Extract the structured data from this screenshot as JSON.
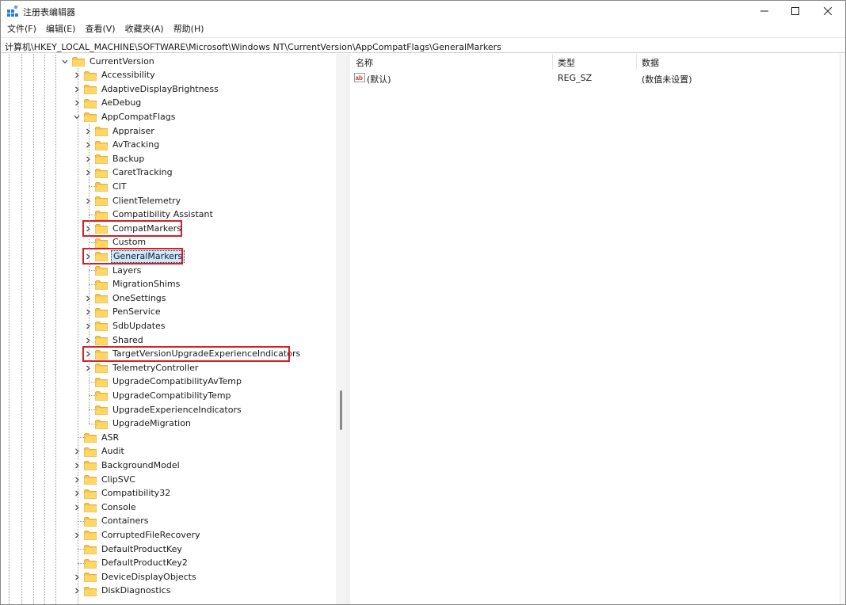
{
  "window": {
    "title": "注册表编辑器",
    "buttons": [
      "minimize",
      "maximize",
      "close"
    ]
  },
  "menu": [
    "文件(F)",
    "编辑(E)",
    "查看(V)",
    "收藏夹(A)",
    "帮助(H)"
  ],
  "address": "计算机\\HKEY_LOCAL_MACHINE\\SOFTWARE\\Microsoft\\Windows NT\\CurrentVersion\\AppCompatFlags\\GeneralMarkers",
  "tree": {
    "root": {
      "label": "CurrentVersion",
      "expanded": true
    },
    "level1_before": [
      {
        "label": "Accessibility",
        "expandable": true
      },
      {
        "label": "AdaptiveDisplayBrightness",
        "expandable": true
      },
      {
        "label": "AeDebug",
        "expandable": true
      }
    ],
    "appcompat": {
      "label": "AppCompatFlags",
      "expanded": true
    },
    "appcompat_children": [
      {
        "label": "Appraiser",
        "expandable": true
      },
      {
        "label": "AvTracking",
        "expandable": true
      },
      {
        "label": "Backup",
        "expandable": true
      },
      {
        "label": "CaretTracking",
        "expandable": true
      },
      {
        "label": "CIT",
        "expandable": false
      },
      {
        "label": "ClientTelemetry",
        "expandable": true
      },
      {
        "label": "Compatibility Assistant",
        "expandable": false
      },
      {
        "label": "CompatMarkers",
        "expandable": true,
        "highlighted": true
      },
      {
        "label": "Custom",
        "expandable": false
      },
      {
        "label": "GeneralMarkers",
        "expandable": true,
        "highlighted": true,
        "selected": true
      },
      {
        "label": "Layers",
        "expandable": false
      },
      {
        "label": "MigrationShims",
        "expandable": false
      },
      {
        "label": "OneSettings",
        "expandable": true
      },
      {
        "label": "PenService",
        "expandable": true
      },
      {
        "label": "SdbUpdates",
        "expandable": true
      },
      {
        "label": "Shared",
        "expandable": true
      },
      {
        "label": "TargetVersionUpgradeExperienceIndicators",
        "expandable": true,
        "highlighted": true
      },
      {
        "label": "TelemetryController",
        "expandable": true
      },
      {
        "label": "UpgradeCompatibilityAvTemp",
        "expandable": false
      },
      {
        "label": "UpgradeCompatibilityTemp",
        "expandable": false
      },
      {
        "label": "UpgradeExperienceIndicators",
        "expandable": false
      },
      {
        "label": "UpgradeMigration",
        "expandable": false
      }
    ],
    "level1_after": [
      {
        "label": "ASR",
        "expandable": false
      },
      {
        "label": "Audit",
        "expandable": true
      },
      {
        "label": "BackgroundModel",
        "expandable": true
      },
      {
        "label": "ClipSVC",
        "expandable": true
      },
      {
        "label": "Compatibility32",
        "expandable": true
      },
      {
        "label": "Console",
        "expandable": true
      },
      {
        "label": "Containers",
        "expandable": false
      },
      {
        "label": "CorruptedFileRecovery",
        "expandable": true
      },
      {
        "label": "DefaultProductKey",
        "expandable": false
      },
      {
        "label": "DefaultProductKey2",
        "expandable": false
      },
      {
        "label": "DeviceDisplayObjects",
        "expandable": true
      },
      {
        "label": "DiskDiagnostics",
        "expandable": true
      }
    ]
  },
  "list": {
    "columns": [
      "名称",
      "类型",
      "数据"
    ],
    "rows": [
      {
        "name": "(默认)",
        "type": "REG_SZ",
        "data": "(数值未设置)",
        "icon": "string-value-icon"
      }
    ]
  },
  "colors": {
    "highlight_box": "#d61e2a",
    "selection": "#cce8ff",
    "folder": "#f6c342"
  }
}
